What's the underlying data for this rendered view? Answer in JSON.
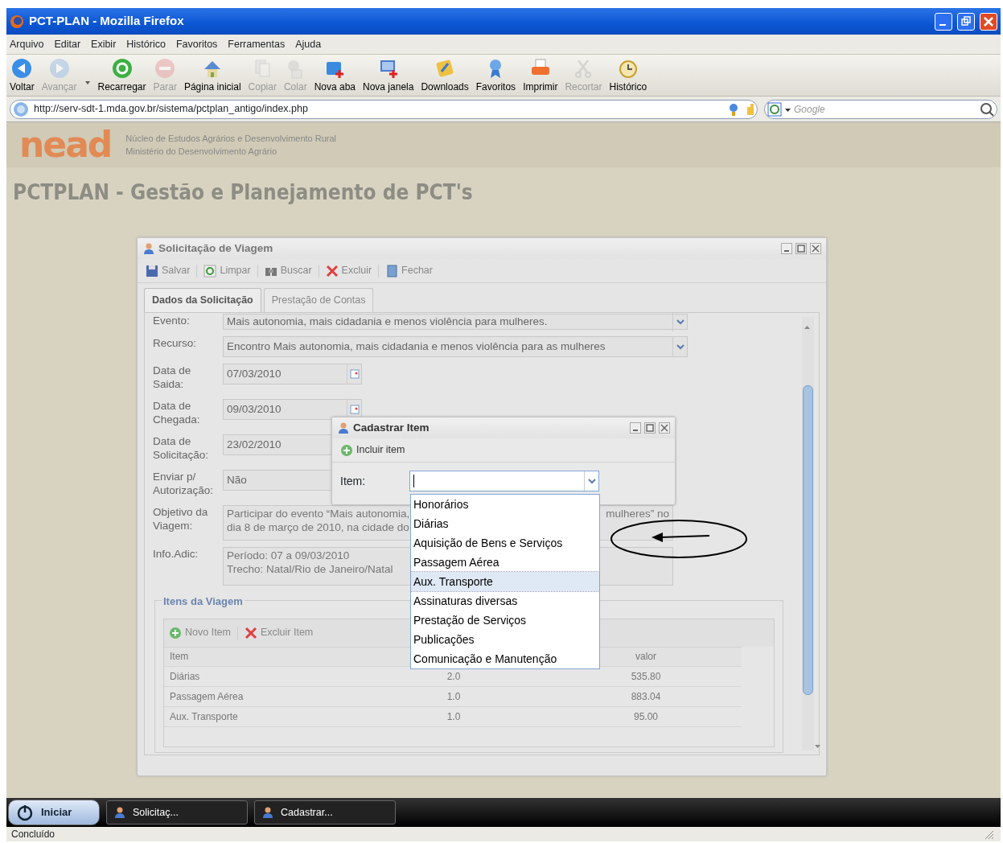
{
  "browser": {
    "title": "PCT-PLAN - Mozilla Firefox",
    "menu": [
      "Arquivo",
      "Editar",
      "Exibir",
      "Histórico",
      "Favoritos",
      "Ferramentas",
      "Ajuda"
    ],
    "toolbar": [
      {
        "label": "Voltar",
        "disabled": false
      },
      {
        "label": "Avançar",
        "disabled": true
      },
      {
        "label": "Recarregar",
        "disabled": false
      },
      {
        "label": "Parar",
        "disabled": true
      },
      {
        "label": "Página inicial",
        "disabled": false
      },
      {
        "label": "Copiar",
        "disabled": true
      },
      {
        "label": "Colar",
        "disabled": true
      },
      {
        "label": "Nova aba",
        "disabled": false
      },
      {
        "label": "Nova janela",
        "disabled": false
      },
      {
        "label": "Downloads",
        "disabled": false
      },
      {
        "label": "Favoritos",
        "disabled": false
      },
      {
        "label": "Imprimir",
        "disabled": false
      },
      {
        "label": "Recortar",
        "disabled": true
      },
      {
        "label": "Histórico",
        "disabled": false
      }
    ],
    "url": "http://serv-sdt-1.mda.gov.br/sistema/pctplan_antigo/index.php",
    "search_placeholder": "Google"
  },
  "header": {
    "logo": "nead",
    "org_lines": [
      "Núcleo de Estudos Agrários e Desenvolvimento Rural",
      "Ministério do Desenvolvimento Agrário"
    ],
    "app_title": "PCTPLAN - Gestão e Planejamento de PCT's"
  },
  "main_window": {
    "title": "Solicitação de Viagem",
    "toolbar": [
      "Salvar",
      "Limpar",
      "Buscar",
      "Excluir",
      "Fechar"
    ],
    "tabs": [
      {
        "label": "Dados da Solicitação",
        "selected": true
      },
      {
        "label": "Prestação de Contas",
        "selected": false
      }
    ],
    "fields": [
      {
        "kind": "select",
        "label": "Evento:",
        "value": "Mais autonomia, mais cidadania e menos violência para mulheres."
      },
      {
        "kind": "select",
        "label": "Recurso:",
        "value": "Encontro Mais autonomia, mais cidadania e menos violência para as mulheres"
      },
      {
        "kind": "date",
        "label": "Data de Saida:",
        "value": "07/03/2010"
      },
      {
        "kind": "date",
        "label": "Data de Chegada:",
        "value": "09/03/2010"
      },
      {
        "kind": "date",
        "label": "Data de Solicitação:",
        "value": "23/02/2010"
      },
      {
        "kind": "text",
        "label": "Enviar p/ Autorização:",
        "value": "Não"
      },
      {
        "kind": "textarea",
        "label": "Objetivo da Viagem:",
        "lines": [
          [
            "Participar do evento “Mais autonomia,",
            "mulheres” no"
          ],
          [
            "dia 8 de março de 2010, na cidade do"
          ]
        ]
      },
      {
        "kind": "textarea",
        "label": "Info.Adic:",
        "lines": [
          [
            "Período: 07 a 09/03/2010"
          ],
          [
            "Trecho:  Natal/Rio de Janeiro/Natal"
          ]
        ]
      }
    ],
    "items": {
      "title": "Itens da Viagem",
      "toolbar": [
        "Novo Item",
        "Excluir Item"
      ],
      "columns": [
        {
          "label": "Item"
        },
        {},
        {
          "label": "valor"
        }
      ],
      "rows": [
        [
          "Diárias",
          "2.0",
          "535.80"
        ],
        [
          "Passagem Aérea",
          "1.0",
          "883.04"
        ],
        [
          "Aux. Transporte",
          "1.0",
          "95.00"
        ]
      ]
    }
  },
  "dialog": {
    "title": "Cadastrar Item",
    "toolbar": [
      "Incluir item"
    ],
    "field_label": "Item:",
    "options": [
      {
        "label": "Honorários",
        "selected": false
      },
      {
        "label": "Diárias",
        "selected": false
      },
      {
        "label": "Aquisição de Bens e Serviços",
        "selected": false
      },
      {
        "label": "Passagem Aérea",
        "selected": false
      },
      {
        "label": "Aux. Transporte",
        "selected": true
      },
      {
        "label": "Assinaturas diversas",
        "selected": false
      },
      {
        "label": "Prestação de Serviços",
        "selected": false
      },
      {
        "label": "Publicações",
        "selected": false
      },
      {
        "label": "Comunicação e Manutenção",
        "selected": false
      }
    ]
  },
  "taskbar": {
    "start": "Iniciar",
    "tasks": [
      "Solicitaç...",
      "Cadastrar..."
    ]
  },
  "status_bar": "Concluído"
}
